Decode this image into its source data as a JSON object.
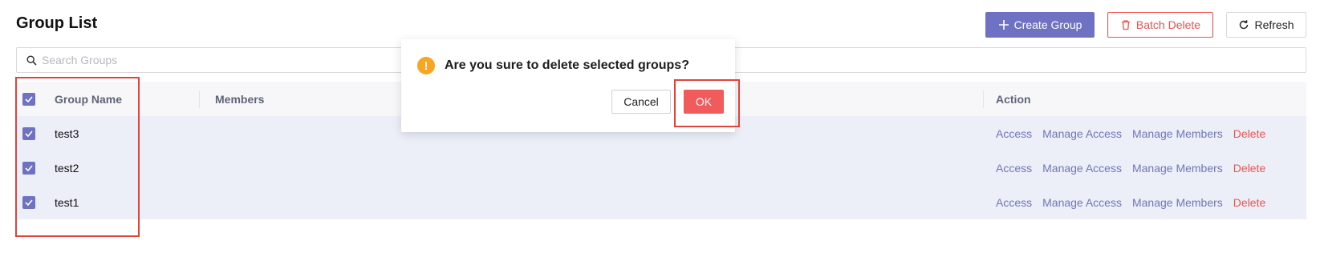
{
  "header": {
    "title": "Group List",
    "create_label": "Create Group",
    "batch_delete_label": "Batch Delete",
    "refresh_label": "Refresh"
  },
  "search": {
    "placeholder": "Search Groups",
    "value": ""
  },
  "table": {
    "columns": [
      "Group Name",
      "Members",
      "Action"
    ],
    "rows": [
      {
        "name": "test3",
        "checked": true
      },
      {
        "name": "test2",
        "checked": true
      },
      {
        "name": "test1",
        "checked": true
      }
    ],
    "actions": [
      "Access",
      "Manage Access",
      "Manage Members",
      "Delete"
    ]
  },
  "dialog": {
    "message": "Are you sure to delete selected groups?",
    "icon": "warning-icon",
    "icon_glyph": "!",
    "cancel_label": "Cancel",
    "ok_label": "OK"
  },
  "colors": {
    "primary": "#6f72c2",
    "danger": "#ef5350",
    "warning": "#f5a623",
    "highlight": "#e0453d"
  }
}
